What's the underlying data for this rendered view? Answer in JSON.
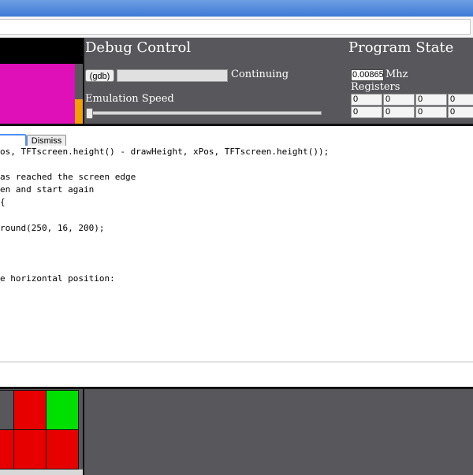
{
  "debug_control": {
    "title": "Debug Control",
    "gdb_button": "(gdb)",
    "command_value": "",
    "status": "Continuing",
    "emulation_speed_label": "Emulation Speed",
    "emulation_speed": 0.0
  },
  "program_state": {
    "title": "Program State",
    "speed_value": "0.00865",
    "speed_unit": "Mhz",
    "registers_label": "Registers",
    "registers": [
      "0",
      "0",
      "0",
      "0",
      "0",
      "0",
      "0",
      "0"
    ]
  },
  "screen_colors": {
    "top_bar": "#000000",
    "main": "#e010b8",
    "accent": "#f0a000"
  },
  "alert": {
    "input_value": "",
    "dismiss_label": "Dismiss"
  },
  "code": {
    "lines": [
      "os, TFTscreen.height() - drawHeight, xPos, TFTscreen.height());",
      "",
      "as reached the screen edge",
      "en and start again",
      "{",
      "",
      "round(250, 16, 200);",
      "",
      "",
      "",
      "e horizontal position:"
    ]
  },
  "led_grid": {
    "rows": [
      [
        "#58575c",
        "#e60000",
        "#00e000"
      ],
      [
        "#e60000",
        "#e60000",
        "#e60000"
      ]
    ]
  }
}
